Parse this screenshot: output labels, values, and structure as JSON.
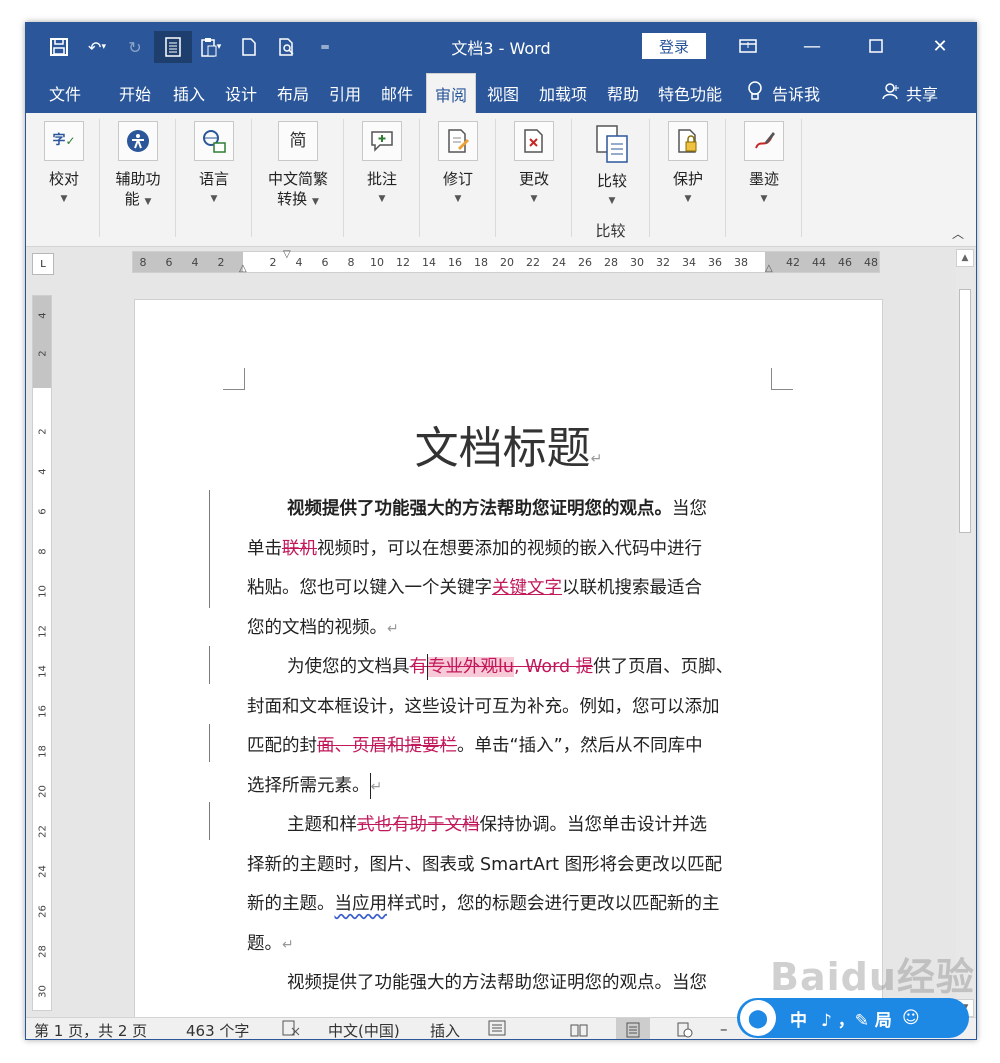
{
  "titlebar": {
    "doc_title": "文档3 - Word",
    "login": "登录"
  },
  "tabs": [
    "文件",
    "开始",
    "插入",
    "设计",
    "布局",
    "引用",
    "邮件",
    "审阅",
    "视图",
    "加载项",
    "帮助",
    "特色功能"
  ],
  "active_tab": "审阅",
  "tell_me": "告诉我",
  "share": "共享",
  "ribbon": {
    "proofing": "校对",
    "accessibility_l1": "辅助功",
    "accessibility_l2": "能",
    "language": "语言",
    "chinese_conv_l1": "中文简繁",
    "chinese_conv_l2": "转换",
    "comments": "批注",
    "tracking": "修订",
    "changes": "更改",
    "compare": "比较",
    "compare_group": "比较",
    "protect": "保护",
    "ink": "墨迹",
    "chinese_conv_icon_char": "简",
    "proofing_icon_char": "字"
  },
  "ruler": {
    "h_ticks": [
      "8",
      "6",
      "4",
      "2",
      "2",
      "4",
      "6",
      "8",
      "10",
      "12",
      "14",
      "16",
      "18",
      "20",
      "22",
      "24",
      "26",
      "28",
      "30",
      "32",
      "34",
      "36",
      "38",
      "42",
      "44",
      "46",
      "48"
    ],
    "v_ticks": [
      "4",
      "2",
      "2",
      "4",
      "6",
      "8",
      "10",
      "12",
      "14",
      "16",
      "18",
      "20",
      "22",
      "24",
      "26",
      "28",
      "30"
    ],
    "tab_selector": "L"
  },
  "document": {
    "title": "文档标题",
    "p1": {
      "bold": "视频提供了功能强大的方法帮助您证明您的观点。",
      "l1_tail": "当您",
      "l2_a": "单击",
      "l2_del": "联机",
      "l2_b": "视频时，可以在想要添加的视频的嵌入代码中进行",
      "l3_a": "粘贴。您也可以键入一个关键字",
      "l3_ins": "关键文字",
      "l3_b": "以联机搜索最适合",
      "l4": "您的文档的视频。"
    },
    "p2": {
      "l1_a": "为使您的文档具",
      "l1_del1": "有",
      "l1_del_hl": "专业外观",
      "l1_del_hl2": "lu",
      "l1_del2": ", Word 提",
      "l1_b": "供了页眉、页脚、",
      "l2": "封面和文本框设计，这些设计可互为补充。例如，您可以添加",
      "l3_a": "匹配的封",
      "l3_del": "面、页眉和提要栏",
      "l3_b": "。单击“插入”，然后从不同库中",
      "l4": "选择所需元素。"
    },
    "p3": {
      "l1_a": "主题和样",
      "l1_del": "式也有助于文档",
      "l1_b": "保持协调。当您单击设计并选",
      "l2": "择新的主题时，图片、图表或 SmartArt 图形将会更改以匹配",
      "l3_a": "新的主题。",
      "l3_sq": "当应用",
      "l3_b": "样式时，您的标题会进行更改以匹配新的主",
      "l4": "题。"
    },
    "p4": {
      "l1": "视频提供了功能强大的方法帮助您证明您的观点。当您"
    },
    "para_mark": "↵"
  },
  "status": {
    "page": "第 1 页，共 2 页",
    "words": "463 个字",
    "language": "中文(中国)",
    "mode": "插入"
  },
  "ime": {
    "label": "中",
    "extra": "♪ ，✎ 局"
  },
  "watermark": "Baidu经验",
  "colors": {
    "word_blue": "#2b579a",
    "revision": "#c2185b",
    "highlight": "#f8c9d6"
  }
}
